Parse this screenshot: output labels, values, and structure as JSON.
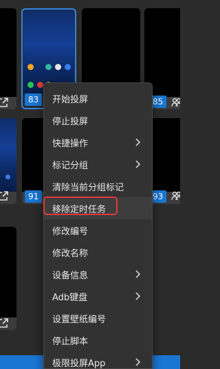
{
  "tiles": {
    "row1": [
      "",
      "83",
      "",
      "85"
    ],
    "row2": [
      "91",
      "",
      "93"
    ]
  },
  "menu": {
    "items": [
      {
        "label": "开始投屏",
        "submenu": false
      },
      {
        "label": "停止投屏",
        "submenu": false
      },
      {
        "label": "快捷操作",
        "submenu": true
      },
      {
        "label": "标记分组",
        "submenu": true
      },
      {
        "label": "清除当前分组标记",
        "submenu": false
      },
      {
        "label": "移除定时任务",
        "submenu": false
      },
      {
        "label": "修改编号",
        "submenu": false
      },
      {
        "label": "修改名称",
        "submenu": false
      },
      {
        "label": "设备信息",
        "submenu": true
      },
      {
        "label": "Adb键盘",
        "submenu": true
      },
      {
        "label": "设置壁纸编号",
        "submenu": false
      },
      {
        "label": "停止脚本",
        "submenu": false
      },
      {
        "label": "极限投屏App",
        "submenu": true
      }
    ],
    "highlighted": "移除定时任务"
  },
  "colors": {
    "accent": "#1976d2",
    "selection": "#2f86e6",
    "highlight_box": "#e03b3b",
    "menu_bg": "#323232"
  }
}
